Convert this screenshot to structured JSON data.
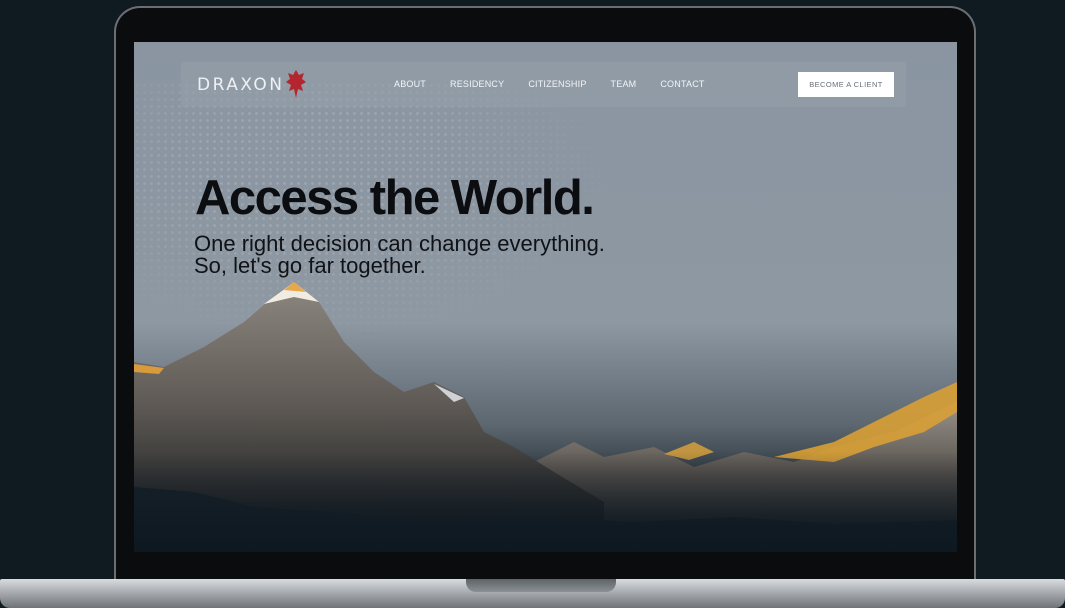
{
  "brand": {
    "name": "DRAXON",
    "logo_icon": "red-dragon-icon",
    "accent": "#b3262e"
  },
  "nav": {
    "items": [
      "ABOUT",
      "RESIDENCY",
      "CITIZENSHIP",
      "TEAM",
      "CONTACT"
    ],
    "cta": "BECOME A CLIENT"
  },
  "hero": {
    "headline": "Access the World.",
    "subline_1": "One right decision can change everything.",
    "subline_2": "So, let's go far together."
  }
}
